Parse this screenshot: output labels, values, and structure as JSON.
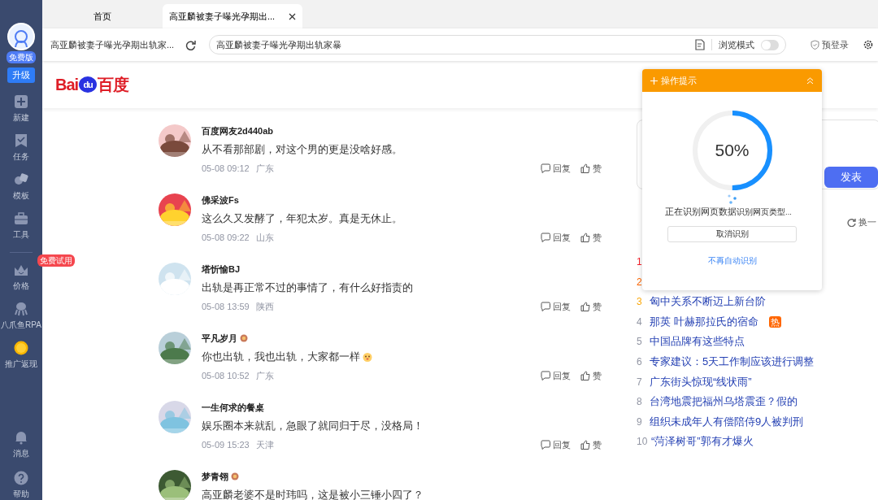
{
  "sidebar": {
    "plan_badge": "免费版",
    "upgrade_button": "升级",
    "items": [
      {
        "kind": "plus",
        "label": "新建"
      },
      {
        "kind": "task",
        "label": "任务"
      },
      {
        "kind": "template",
        "label": "模板"
      },
      {
        "kind": "tool",
        "label": "工具"
      },
      {
        "kind": "divider"
      },
      {
        "kind": "crown",
        "label": "价格",
        "badge": "免费试用"
      },
      {
        "kind": "octopus",
        "label": "八爪鱼RPA"
      },
      {
        "kind": "coin",
        "label": "推广返现"
      }
    ],
    "bottom_items": [
      {
        "kind": "bell",
        "label": "消息"
      },
      {
        "kind": "help",
        "label": "帮助"
      }
    ]
  },
  "tabs": [
    {
      "label": "首页",
      "selected": false,
      "closable": false
    },
    {
      "label": "高亚麟被妻子曝光孕期出...",
      "selected": true,
      "closable": true
    }
  ],
  "address_bar": {
    "page_title": "高亚麟被妻子曝光孕期出轨家...",
    "url": "高亚麟被妻子曝光孕期出轨家暴",
    "browse_mode_label": "浏览模式",
    "browse_mode_on": false,
    "login_label": "预登录"
  },
  "site": {
    "logo_latin": "Bai",
    "logo_du": "du",
    "logo_cn": "百度"
  },
  "comments": [
    {
      "user": "百度网友2d440ab",
      "badge": false,
      "text": "从不看那部剧，对这个男的更是没啥好感。",
      "time": "05-08 09:12",
      "region": "广东",
      "reply": "回复",
      "like": "赞"
    },
    {
      "user": "佛采波Fs",
      "badge": false,
      "text": "这么久又发酵了，年犯太岁。真是无休止。",
      "time": "05-08 09:22",
      "region": "山东",
      "reply": "回复",
      "like": "赞"
    },
    {
      "user": "塔忻愉BJ",
      "badge": false,
      "text": "出轨是再正常不过的事情了，有什么好指责的",
      "time": "05-08 13:59",
      "region": "陕西",
      "reply": "回复",
      "like": "赞"
    },
    {
      "user": "平凡岁月",
      "badge": true,
      "text": "你也出轨，我也出轨，大家都一样",
      "emoji": true,
      "time": "05-08 10:52",
      "region": "广东",
      "reply": "回复",
      "like": "赞"
    },
    {
      "user": "一生何求的餐桌",
      "badge": false,
      "text": "娱乐圈本来就乱，急眼了就同归于尽，没格局！",
      "time": "05-09 15:23",
      "region": "天津",
      "reply": "回复",
      "like": "赞"
    },
    {
      "user": "梦青翎",
      "badge": true,
      "text": "高亚麟老婆不是时玮吗，这是被小三锤小四了？"
    }
  ],
  "composer": {
    "submit_button": "发表"
  },
  "hot_list": {
    "refresh_label": "换一",
    "items": [
      {
        "rank": "1",
        "color": "#f5222d"
      },
      {
        "rank": "2",
        "color": "#ff6600"
      },
      {
        "rank": "3",
        "color": "#faa90e",
        "title": "匈中关系不断迈上新台阶"
      },
      {
        "rank": "4",
        "color": "#9195a3",
        "title": "那英 叶赫那拉氏的宿命",
        "hot_tag": "热"
      },
      {
        "rank": "5",
        "color": "#9195a3",
        "title": "中国品牌有这些特点"
      },
      {
        "rank": "6",
        "color": "#9195a3",
        "title": "专家建议：5天工作制应该进行调整"
      },
      {
        "rank": "7",
        "color": "#9195a3",
        "title": "广东街头惊现“线状雨”"
      },
      {
        "rank": "8",
        "color": "#9195a3",
        "title": "台湾地震把福州乌塔震歪？假的"
      },
      {
        "rank": "9",
        "color": "#9195a3",
        "title": "组织未成年人有偿陪侍9人被判刑"
      },
      {
        "rank": "10",
        "color": "#9195a3",
        "title": "“菏泽树哥”郭有才爆火"
      }
    ]
  },
  "popup": {
    "title": "操作提示",
    "level": 0.5,
    "percent": "50%",
    "status": "正在识别网页数据",
    "substatus": "识别网页类型...",
    "cancel_button": "取消识别",
    "link": "不再自动识别"
  }
}
